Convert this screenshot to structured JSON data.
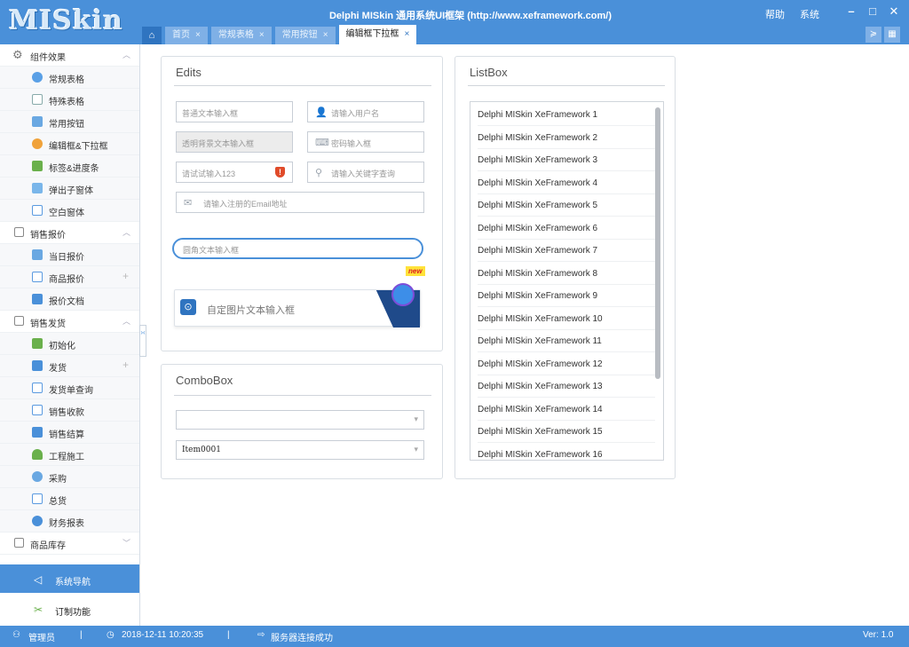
{
  "app": {
    "logo": "MISkin",
    "title": "Delphi MISkin 通用系统UI框架 (http://www.xeframework.com/)",
    "menu": [
      "帮助",
      "系统"
    ],
    "window_buttons": [
      "–",
      "□",
      "✕"
    ]
  },
  "tabs": {
    "home_icon": "home-icon",
    "items": [
      {
        "label": "首页",
        "close": "×"
      },
      {
        "label": "常规表格",
        "close": "×"
      },
      {
        "label": "常用按钮",
        "close": "×"
      },
      {
        "label": "编辑框下拉框",
        "close": "×",
        "active": true
      }
    ],
    "right_buttons": [
      "≽",
      "▦"
    ]
  },
  "sidebar": {
    "groups": [
      {
        "label": "组件效果",
        "chev": "︿",
        "items": [
          "常规表格",
          "特殊表格",
          "常用按钮",
          "编辑框&下拉框",
          "标签&进度条",
          "弹出子窗体",
          "空白窗体"
        ]
      },
      {
        "label": "销售报价",
        "chev": "︿",
        "items": [
          "当日报价",
          "商品报价",
          "报价文档"
        ]
      },
      {
        "label": "销售发货",
        "chev": "︿",
        "items": [
          "初始化",
          "发货",
          "发货单查询",
          "销售收款",
          "销售结算",
          "工程施工",
          "采购",
          "总货",
          "财务报表"
        ]
      },
      {
        "label": "商品库存",
        "chev": "﹀",
        "items": []
      }
    ],
    "plus": "+",
    "nav_primary": {
      "icon": "◁",
      "label": "系统导航"
    },
    "nav_secondary": {
      "icon": "✂",
      "label": "订制功能"
    },
    "collapse_arrows": "›‹"
  },
  "edits": {
    "title": "Edits",
    "plain_placeholder": "普通文本输入框",
    "username_placeholder": "请输入用户名",
    "transparent_placeholder": "透明背景文本输入框",
    "password_placeholder": "密码输入框",
    "test_value": "请试试输入123",
    "keyword_placeholder": "请输入关键字查询",
    "email_placeholder": "请输入注册的Email地址",
    "rounded_placeholder": "圆角文本输入框",
    "image_placeholder": "自定图片文本输入框",
    "new_badge": "new"
  },
  "combobox": {
    "title": "ComboBox",
    "first_value": "",
    "second_value": "Item0001"
  },
  "listbox": {
    "title": "ListBox",
    "items": [
      "Delphi MISkin XeFramework 1",
      "Delphi MISkin XeFramework 2",
      "Delphi MISkin XeFramework 3",
      "Delphi MISkin XeFramework 4",
      "Delphi MISkin XeFramework 5",
      "Delphi MISkin XeFramework 6",
      "Delphi MISkin XeFramework 7",
      "Delphi MISkin XeFramework 8",
      "Delphi MISkin XeFramework 9",
      "Delphi MISkin XeFramework 10",
      "Delphi MISkin XeFramework 11",
      "Delphi MISkin XeFramework 12",
      "Delphi MISkin XeFramework 13",
      "Delphi MISkin XeFramework 14",
      "Delphi MISkin XeFramework 15",
      "Delphi MISkin XeFramework 16"
    ]
  },
  "status": {
    "user": "管理员",
    "separator": "|",
    "datetime": "2018-12-11 10:20:35",
    "server": "服务器连接成功",
    "version": "Ver: 1.0"
  },
  "colors": {
    "primary": "#4a90d9",
    "dark": "#2f74c0",
    "alert": "#e04b2a"
  }
}
